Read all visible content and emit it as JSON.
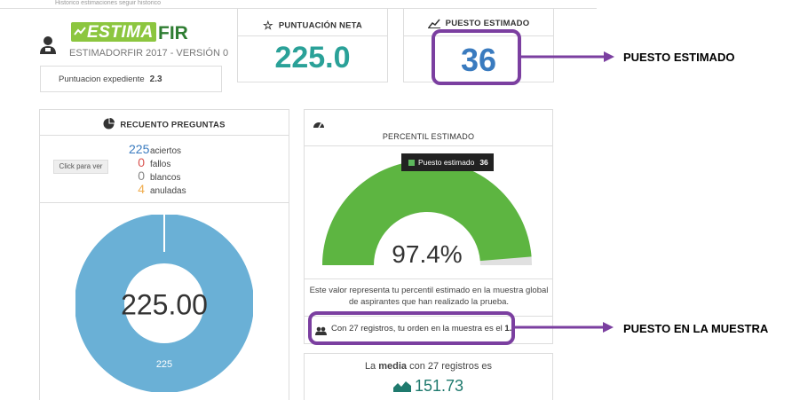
{
  "breadcrumb": "Historico estimaciones seguir historico",
  "logo": {
    "estima": "ESTIMA",
    "fir": "FIR"
  },
  "subtitle": "ESTIMADORFIR 2017 - VERSIÓN 0",
  "expediente": {
    "label": "Puntuacion expediente",
    "value": "2.3"
  },
  "puntuacion_neta": {
    "title": "PUNTUACIÓN NETA",
    "value": "225.0"
  },
  "puesto_estimado": {
    "title": "PUESTO ESTIMADO",
    "value": "36"
  },
  "recuento": {
    "title": "RECUENTO PREGUNTAS",
    "click_label": "Click para ver",
    "rows": [
      {
        "n": "225",
        "label": "aciertos",
        "color": "#3a7bbf"
      },
      {
        "n": "0",
        "label": "fallos",
        "color": "#d9534f"
      },
      {
        "n": "0",
        "label": "blancos",
        "color": "#888888"
      },
      {
        "n": "4",
        "label": "anuladas",
        "color": "#f0ad4e"
      }
    ],
    "donut_center": "225.00",
    "donut_label": "225",
    "donut_color": "#6ab0d6"
  },
  "percentil": {
    "title": "PERCENTIL ESTIMADO",
    "tooltip_label": "Puesto estimado",
    "tooltip_value": "36",
    "gauge_fraction": 0.974,
    "gauge_value": "97.4%",
    "gauge_color": "#5db541",
    "description": "Este valor representa tu percentil estimado en la muestra global de aspirantes que han realizado la prueba.",
    "muestra_prefix": "Con 27 registros, tu orden en la muestra es el",
    "muestra_value": "1."
  },
  "media": {
    "text_pre": "La",
    "text_bold": "media",
    "text_post": "con 27 registros es",
    "value": "151.73"
  },
  "annotations": {
    "puesto_estimado": "PUESTO ESTIMADO",
    "puesto_muestra": "PUESTO EN LA MUESTRA",
    "color": "#7b3fa0"
  }
}
